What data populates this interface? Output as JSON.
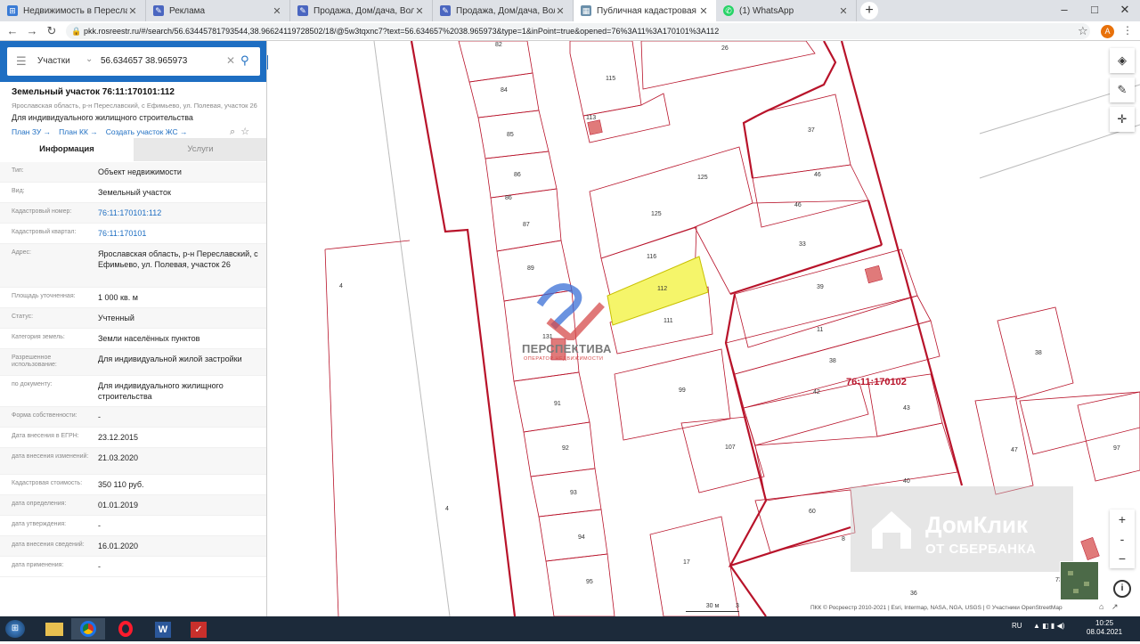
{
  "browser": {
    "tabs": [
      {
        "title": "Недвижимость в Переславле-З",
        "icon": "windows-logo-icon",
        "color": "#3a7bd5",
        "active": false
      },
      {
        "title": "Реклама",
        "icon": "pen-icon",
        "color": "#4a66c0",
        "active": false
      },
      {
        "title": "Продажа, Дом/дача, Волжский",
        "icon": "pen-icon",
        "color": "#4a66c0",
        "active": false
      },
      {
        "title": "Продажа, Дом/дача, Волжский",
        "icon": "pen-icon",
        "color": "#4a66c0",
        "active": false
      },
      {
        "title": "Публичная кадастровая карта",
        "icon": "map-icon",
        "color": "#6a8faa",
        "active": true
      },
      {
        "title": "(1) WhatsApp",
        "icon": "whatsapp-icon",
        "color": "#25d366",
        "active": false
      }
    ],
    "new_tab": "+",
    "url": "pkk.rosreestr.ru/#/search/56.63445781793544,38.96624119728502/18/@5w3tqxnc7?text=56.634657%2038.965973&type=1&inPoint=true&opened=76%3A11%3A170101%3A112",
    "account_initial": "A",
    "window_controls": [
      "–",
      "□",
      "✕"
    ]
  },
  "search": {
    "category": "Участки",
    "query": "56.634657 38.965973"
  },
  "parcel": {
    "title": "Земельный участок 76:11:170101:112",
    "address_line": "Ярославская область, р-н Переславский, с Ефимьево, ул. Полевая, участок 26",
    "purpose": "Для индивидуального жилищного строительства",
    "links": [
      "План ЗУ →",
      "План КК →",
      "Создать участок ЖС →"
    ],
    "tabs": [
      "Информация",
      "Услуги"
    ]
  },
  "info_rows": [
    {
      "label": "Тип:",
      "value": "Объект недвижимости",
      "link": false
    },
    {
      "label": "Вид:",
      "value": "Земельный участок",
      "link": false
    },
    {
      "label": "Кадастровый номер:",
      "value": "76:11:170101:112",
      "link": true
    },
    {
      "label": "Кадастровый квартал:",
      "value": "76:11:170101",
      "link": true
    },
    {
      "label": "Адрес:",
      "value": "Ярославская область, р-н Переславский, с Ефимьево, ул. Полевая, участок 26",
      "link": false
    },
    {
      "label": "Площадь уточненная:",
      "value": "1 000 кв. м",
      "link": false
    },
    {
      "label": "Статус:",
      "value": "Учтенный",
      "link": false
    },
    {
      "label": "Категория земель:",
      "value": "Земли населённых пунктов",
      "link": false
    },
    {
      "label": "Разрешенное использование:",
      "value": "Для индивидуальной жилой застройки",
      "link": false
    },
    {
      "label": "по документу:",
      "value": "Для индивидуального жилищного строительства",
      "link": false
    },
    {
      "label": "Форма собственности:",
      "value": "-",
      "link": false
    },
    {
      "label": "Дата внесения в ЕГРН:",
      "value": "23.12.2015",
      "link": false
    },
    {
      "label": "дата внесения изменений:",
      "value": "21.03.2020",
      "link": false
    },
    {
      "label": "Кадастровая стоимость:",
      "value": "350 110 руб.",
      "link": false
    },
    {
      "label": "дата определения:",
      "value": "01.01.2019",
      "link": false
    },
    {
      "label": "дата утверждения:",
      "value": "-",
      "link": false
    },
    {
      "label": "дата внесения сведений:",
      "value": "16.01.2020",
      "link": false
    },
    {
      "label": "дата применения:",
      "value": "-",
      "link": false
    }
  ],
  "map": {
    "quarter_label": "76:11:170102",
    "parcel_labels": [
      "82",
      "26",
      "84",
      "115",
      "113",
      "85",
      "37",
      "86",
      "86",
      "125",
      "46",
      "46",
      "125",
      "87",
      "33",
      "116",
      "89",
      "112",
      "39",
      "111",
      "131",
      "11",
      "38",
      "99",
      "91",
      "42",
      "43",
      "92",
      "107",
      "93",
      "40",
      "60",
      "94",
      "8",
      "17",
      "95",
      "36",
      "4",
      "4",
      "38",
      "47",
      "97",
      "73"
    ],
    "watermark1_title": "ПЕРСПЕКТИВА",
    "watermark1_sub": "ОПЕРАТОР НЕДВИЖИМОСТИ",
    "watermark2_title": "ДомКлик",
    "watermark2_sub": "ОТ СБЕРБАНКА",
    "scale": "30 м",
    "scale_extra": "3",
    "attribution": "ПКК © Росреестр 2010-2021 | Esri, Intermap, NASA, NGA, USGS | © Участники OpenStreetMap",
    "zoom_in": "+",
    "zoom_mid": "-",
    "zoom_out": "−",
    "highlight_color": "#f5f56a",
    "boundary_color": "#b8132a"
  },
  "taskbar": {
    "lang": "RU",
    "time": "10:25",
    "date": "08.04.2021"
  }
}
